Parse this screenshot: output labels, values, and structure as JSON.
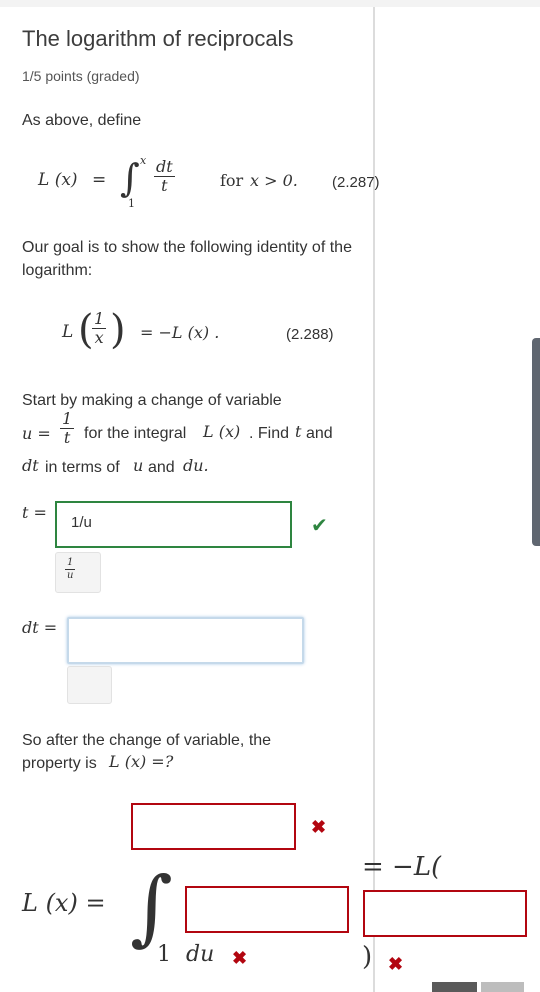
{
  "title": "The logarithm of reciprocals",
  "points": "1/5 points (graded)",
  "intro": "As above, define",
  "eq1": {
    "lhs": "L (x)",
    "equals": "=",
    "integral_upper": "x",
    "integral_lower": "1",
    "frac_num": "dt",
    "frac_den": "t",
    "condition_word": "for",
    "condition_math": "x > 0.",
    "number": "(2.287)"
  },
  "goal_text": "Our goal is to show the following identity of the logarithm:",
  "eq2": {
    "lhs_L": "L",
    "frac_num": "1",
    "frac_den": "x",
    "rhs": "= −L (x) .",
    "number": "(2.288)"
  },
  "step": {
    "line1": "Start by making a change of variable",
    "u_eq": "u =",
    "frac_num": "1",
    "frac_den": "t",
    "for_the_integral": "for the integral",
    "integral_ref": "L (x)",
    "find": ". Find",
    "find_var": "t",
    "and": "and",
    "dt": "dt",
    "in_terms_of": "in terms of",
    "u": "u",
    "and2": "and",
    "du": "du."
  },
  "t_input": {
    "label": "t =",
    "value": "1/u",
    "status": "correct",
    "preview_num": "1",
    "preview_den": "u"
  },
  "dt_input": {
    "label": "dt =",
    "value": ""
  },
  "after_text_1": "So after the change of variable, the",
  "after_text_2_prefix": "property is",
  "after_text_2_math": "L (x) =?",
  "final_eq": {
    "lhs": "L (x) =",
    "integral_lower": "1",
    "du": "du",
    "rhs": "= −L(",
    "close_paren": ")"
  },
  "marks": {
    "check": "✔",
    "cross": "✖"
  }
}
